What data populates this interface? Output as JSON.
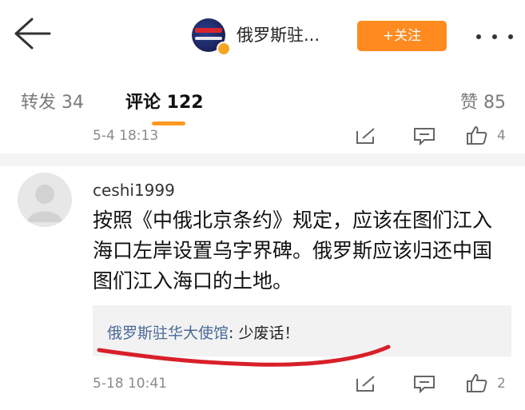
{
  "topbar": {
    "account_name": "俄罗斯驻...",
    "follow_label": "+关注"
  },
  "tabs": {
    "repost": "转发 34",
    "comment": "评论 122",
    "like": "赞 85"
  },
  "comments": [
    {
      "timestamp": "5-4 18:13",
      "like_count": "4"
    },
    {
      "username": "ceshi1999",
      "text": "按照《中俄北京条约》规定，应该在图们江入海口左岸设置乌字界碑。俄罗斯应该归还中国图们江入海口的土地。",
      "reply": {
        "author": "俄罗斯驻华大使馆",
        "separator": ": ",
        "text": "少废话！"
      },
      "timestamp": "5-18 10:41",
      "like_count": "2"
    }
  ],
  "colors": {
    "follow": "#ff8a1f",
    "tab_indicator": "#ff9a22",
    "reply_author": "#4a6a99",
    "annotation": "#d8202a"
  },
  "icons": [
    "back-arrow-icon",
    "more-dots-icon",
    "repost-icon",
    "comment-icon",
    "thumbs-up-icon",
    "verified-badge-icon"
  ]
}
